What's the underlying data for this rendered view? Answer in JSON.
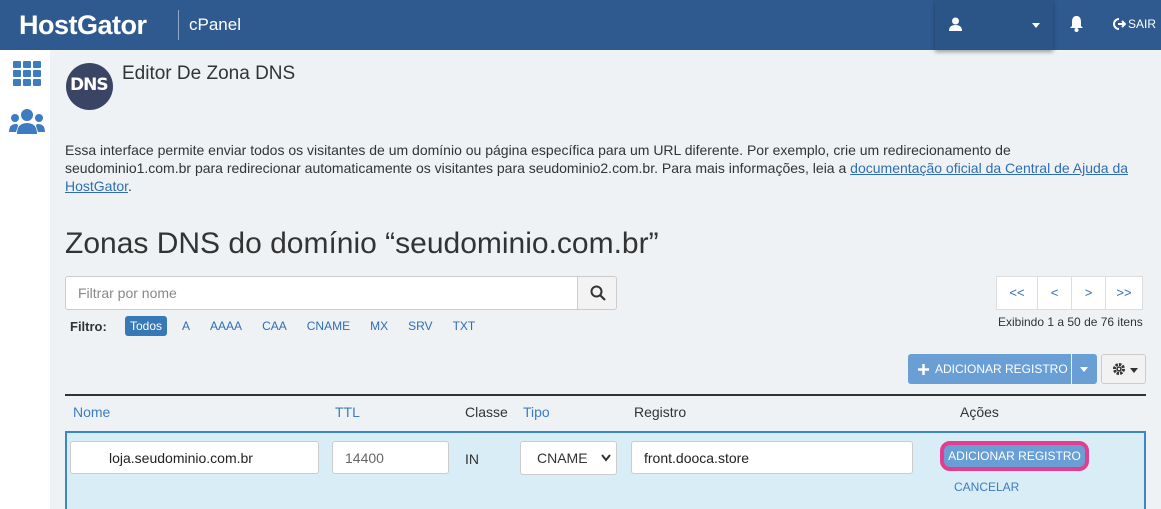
{
  "header": {
    "logo": "HostGator",
    "product": "cPanel",
    "logout_label": "SAIR"
  },
  "page": {
    "icon_text": "DNS",
    "title": "Editor De Zona DNS",
    "description_text": "Essa interface permite enviar todos os visitantes de um domínio ou página específica para um URL diferente. Por exemplo, crie um redirecionamento de seudominio1.com.br para redirecionar automaticamente os visitantes para seudominio2.com.br. Para mais informações, leia a ",
    "description_link": "documentação oficial da Central de Ajuda da HostGator",
    "description_end": ".",
    "zones_title": "Zonas DNS do domínio “seudominio.com.br”"
  },
  "search": {
    "placeholder": "Filtrar por nome"
  },
  "filters": {
    "label": "Filtro:",
    "items": [
      "Todos",
      "A",
      "AAAA",
      "CAA",
      "CNAME",
      "MX",
      "SRV",
      "TXT"
    ],
    "active": "Todos"
  },
  "pagination": {
    "first": "<<",
    "prev": "<",
    "next": ">",
    "last": ">>",
    "info": "Exibindo 1 a 50 de 76 itens"
  },
  "toolbar": {
    "add_record_label": "ADICIONAR REGISTRO"
  },
  "table": {
    "headers": {
      "name": "Nome",
      "ttl": "TTL",
      "class": "Classe",
      "type": "Tipo",
      "record": "Registro",
      "actions": "Ações"
    },
    "edit_row": {
      "name_value": "loja.seudominio.com.br",
      "ttl_value": "14400",
      "class_value": "IN",
      "type_value": "CNAME",
      "record_value": "front.dooca.store",
      "add_label": "ADICIONAR REGISTRO",
      "cancel_label": "CANCELAR"
    }
  },
  "colors": {
    "topbar": "#2f5a8f",
    "accent": "#6a9fd6",
    "highlight": "#e23d8f",
    "row_bg": "#d9edf7"
  }
}
